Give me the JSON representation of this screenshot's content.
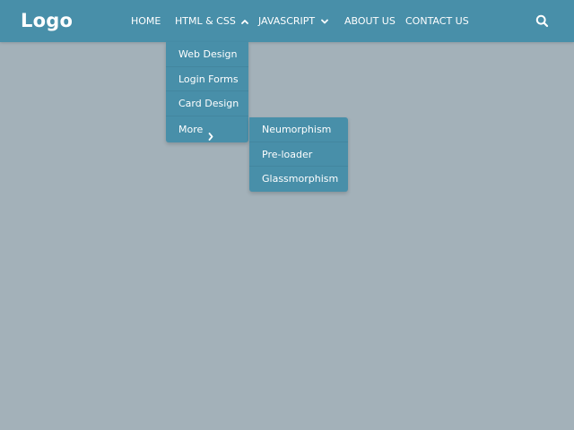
{
  "brand": {
    "logo": "Logo"
  },
  "nav": {
    "home": "HOME",
    "html_css": "HTML & CSS",
    "javascript": "JAVASCRIPT",
    "about": "ABOUT US",
    "contact": "CONTACT US"
  },
  "dropdown": {
    "items": [
      "Web Design",
      "Login Forms",
      "Card Design",
      "More"
    ]
  },
  "submenu": {
    "items": [
      "Neumorphism",
      "Pre-loader",
      "Glassmorphism"
    ]
  },
  "icons": {
    "search": "search-icon",
    "html_css_chevron": "chevron-up-icon",
    "javascript_chevron": "chevron-down-icon",
    "more_chevron": "chevron-right-icon"
  },
  "colors": {
    "accent": "#488fa9",
    "background": "#a3b1b9",
    "text": "#ffffff"
  }
}
